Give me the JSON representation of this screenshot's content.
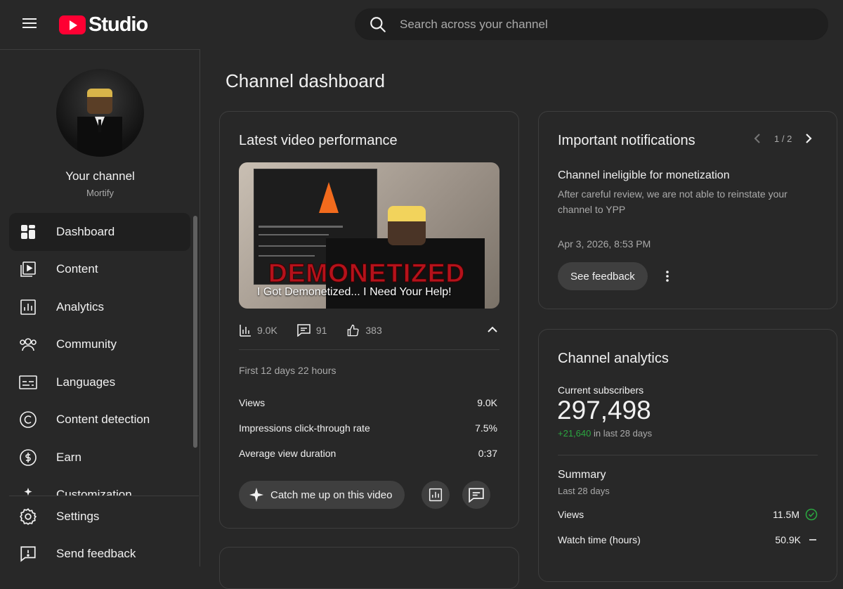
{
  "header": {
    "logo_text": "Studio",
    "search_placeholder": "Search across your channel"
  },
  "sidebar": {
    "channel_name": "Your channel",
    "channel_handle": "Mortify",
    "items": [
      {
        "label": "Dashboard",
        "icon": "dashboard-icon",
        "active": true
      },
      {
        "label": "Content",
        "icon": "content-icon"
      },
      {
        "label": "Analytics",
        "icon": "analytics-icon"
      },
      {
        "label": "Community",
        "icon": "community-icon"
      },
      {
        "label": "Languages",
        "icon": "languages-icon"
      },
      {
        "label": "Content detection",
        "icon": "copyright-icon"
      },
      {
        "label": "Earn",
        "icon": "earn-icon"
      },
      {
        "label": "Customization",
        "icon": "customization-icon"
      }
    ],
    "bottom_items": [
      {
        "label": "Settings",
        "icon": "settings-icon"
      },
      {
        "label": "Send feedback",
        "icon": "feedback-icon"
      }
    ]
  },
  "main": {
    "title": "Channel dashboard",
    "latest_video": {
      "card_title": "Latest video performance",
      "thumbnail_overlay": "DEMONETIZED",
      "video_title": "I Got Demonetized... I Need Your Help!",
      "views_short": "9.0K",
      "comments": "91",
      "likes": "383",
      "period": "First 12 days 22 hours",
      "metrics": [
        {
          "label": "Views",
          "value": "9.0K"
        },
        {
          "label": "Impressions click-through rate",
          "value": "7.5%"
        },
        {
          "label": "Average view duration",
          "value": "0:37"
        }
      ],
      "catch_up_label": "Catch me up on this video"
    },
    "notifications": {
      "card_title": "Important notifications",
      "pager": "1 / 2",
      "item_title": "Channel ineligible for monetization",
      "item_body": "After careful review, we are not able to reinstate your channel to YPP",
      "item_date": "Apr 3, 2026, 8:53 PM",
      "feedback_button": "See feedback"
    },
    "analytics": {
      "card_title": "Channel analytics",
      "subs_label": "Current subscribers",
      "subs_count": "297,498",
      "subs_delta": "+21,640",
      "subs_delta_suffix": " in last 28 days",
      "summary_title": "Summary",
      "summary_period": "Last 28 days",
      "rows": [
        {
          "label": "Views",
          "value": "11.5M",
          "status": "check-icon"
        },
        {
          "label": "Watch time (hours)",
          "value": "50.9K",
          "status": "dash-icon"
        }
      ]
    }
  },
  "colors": {
    "background": "#282828",
    "brand_red": "#ff0033",
    "positive_green": "#2ba640",
    "muted_text": "#aaaaaa"
  }
}
